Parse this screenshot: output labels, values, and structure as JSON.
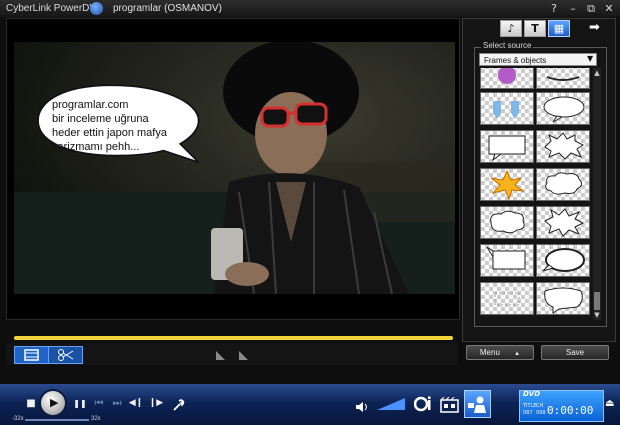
{
  "window": {
    "app_name": "CyberLink PowerDVD",
    "title": "programlar (OSMANOV)",
    "help": "?",
    "minimize": "–",
    "restore": "⧉",
    "close": "✕"
  },
  "video": {
    "bubble_lines": [
      "programlar.com",
      "bir inceleme uğruna",
      "heder ettin japon mafya",
      "karizmamı pehh..."
    ]
  },
  "panel": {
    "tabs": [
      "music-note-icon",
      "text-T-icon",
      "effects-grid-icon"
    ],
    "tab_text": "T",
    "tab_music": "♪",
    "tab_effects": "▦",
    "arrow": "➡",
    "select_source_label": "Select source",
    "source_value": "Frames & objects",
    "menu_label": "Menu",
    "menu_arrow": "▲",
    "save_label": "Save"
  },
  "controls": {
    "speed_min": "-32x",
    "speed_max": "32x",
    "stop": "■",
    "play": "▶",
    "pause": "❚❚",
    "prev": "⏮",
    "next": "⏭",
    "step_back": "◀❙",
    "step_forward": "❙▶",
    "display": {
      "logo": "DVD",
      "title_label": "TITLE",
      "chapter_label": "CH",
      "title_num": "087",
      "chapter_num": "098",
      "time": "0:00:00"
    }
  },
  "colors": {
    "timeline": "#f3d43a",
    "accent": "#1e64c8",
    "control_bar": "#0d2456"
  }
}
